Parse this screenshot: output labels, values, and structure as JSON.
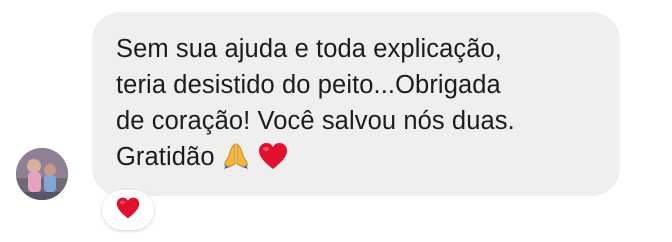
{
  "message": {
    "lines": [
      "Sem sua ajuda e toda explicação,",
      "teria desistido do peito...Obrigada",
      "de coração! Você salvou nós duas.",
      "Gratidão"
    ],
    "trailing_icons": [
      "praying-hands-icon",
      "red-heart-icon"
    ]
  },
  "reaction": {
    "icon": "red-heart-icon",
    "color": "#e0102f"
  },
  "colors": {
    "bubble_bg": "#efefef",
    "text": "#1c1c1e",
    "heart": "#e0102f",
    "hands": "#f4b73a"
  }
}
